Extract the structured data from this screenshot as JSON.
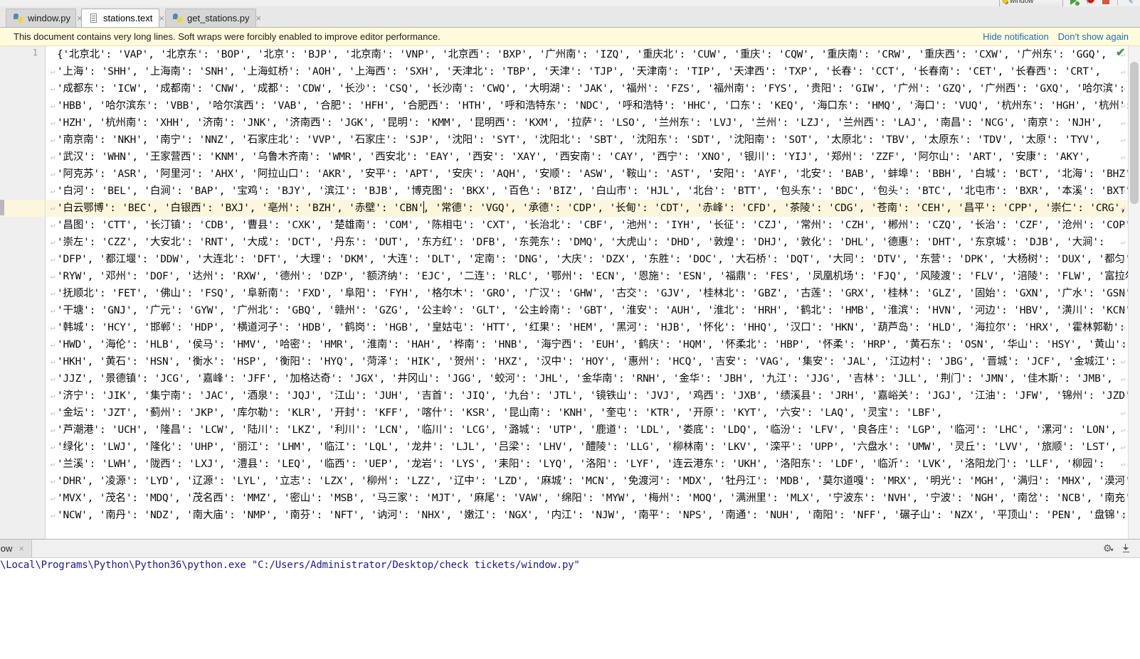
{
  "toolbar": {
    "run_config_label": "window",
    "run_icon": "run-icon",
    "debug_icon": "debug-icon",
    "stop_icon": "stop-icon",
    "wrench_icon": "wrench-icon"
  },
  "tabs": [
    {
      "label": "window.py",
      "icon": "python-file-icon",
      "active": false,
      "close": "×"
    },
    {
      "label": "stations.text",
      "icon": "text-file-icon",
      "active": true,
      "close": "×"
    },
    {
      "label": "get_stations.py",
      "icon": "python-file-icon",
      "active": false,
      "close": "×"
    }
  ],
  "notification": {
    "message": "This document contains very long lines. Soft wraps were forcibly enabled to improve editor performance.",
    "hide_label": "Hide notification",
    "dont_show_label": "Don't show again",
    "link_color": "#1d6fb8",
    "background": "#fffbdc"
  },
  "editor": {
    "line_number": "1",
    "wrap_glyph": "↵",
    "wrap_right_glyph": "↵",
    "caret_line_index": 9,
    "caret_color": "#000000",
    "highlight_color": "#fdf6dd",
    "inspection_ok_glyph": "✔",
    "inspection_ok_color": "#3f9e3f",
    "lines": [
      "{'北京北': 'VAP', '北京东': 'BOP', '北京': 'BJP', '北京南': 'VNP', '北京西': 'BXP', '广州南': 'IZQ', '重庆北': 'CUW', '重庆': 'CQW', '重庆南': 'CRW', '重庆西': 'CXW', '广州东': 'GGQ',",
      "'上海': 'SHH', '上海南': 'SNH', '上海虹桥': 'AOH', '上海西': 'SXH', '天津北': 'TBP', '天津': 'TJP', '天津南': 'TIP', '天津西': 'TXP', '长春': 'CCT', '长春南': 'CET', '长春西': 'CRT',",
      "'成都东': 'ICW', '成都南': 'CNW', '成都': 'CDW', '长沙': 'CSQ', '长沙南': 'CWQ', '大明湖': 'JAK', '福州': 'FZS', '福州南': 'FYS', '贵阳': 'GIW', '广州': 'GZQ', '广州西': 'GXQ', '哈尔滨':",
      "'HBB', '哈尔滨东': 'VBB', '哈尔滨西': 'VAB', '合肥': 'HFH', '合肥西': 'HTH', '呼和浩特东': 'NDC', '呼和浩特': 'HHC', '口东': 'KEQ', '海口东': 'HMQ', '海口': 'VUQ', '杭州东': 'HGH', '杭州':",
      "'HZH', '杭州南': 'XHH', '济南': 'JNK', '济南西': 'JGK', '昆明': 'KMM', '昆明西': 'KXM', '拉萨': 'LSO', '兰州东': 'LVJ', '兰州': 'LZJ', '兰州西': 'LAJ', '南昌': 'NCG', '南京': 'NJH',",
      "'南京南': 'NKH', '南宁': 'NNZ', '石家庄北': 'VVP', '石家庄': 'SJP', '沈阳': 'SYT', '沈阳北': 'SBT', '沈阳东': 'SDT', '沈阳南': 'SOT', '太原北': 'TBV', '太原东': 'TDV', '太原': 'TYV',",
      "'武汉': 'WHN', '王家营西': 'KNM', '乌鲁木齐南': 'WMR', '西安北': 'EAY', '西安': 'XAY', '西安南': 'CAY', '西宁': 'XNO', '银川': 'YIJ', '郑州': 'ZZF', '阿尔山': 'ART', '安康': 'AKY',",
      "'阿克苏': 'ASR', '阿里河': 'AHX', '阿拉山口': 'AKR', '安平': 'APT', '安庆': 'AQH', '安顺': 'ASW', '鞍山': 'AST', '安阳': 'AYF', '北安': 'BAB', '蚌埠': 'BBH', '白城': 'BCT', '北海': 'BHZ',",
      "'白河': 'BEL', '白涧': 'BAP', '宝鸡': 'BJY', '滨江': 'BJB', '博克图': 'BKX', '百色': 'BIZ', '白山市': 'HJL', '北台': 'BTT', '包头东': 'BDC', '包头': 'BTC', '北屯市': 'BXR', '本溪': 'BXT',",
      "'白云鄂博': 'BEC', '白银西': 'BXJ', '亳州': 'BZH', '赤壁': 'CBN', '常德': 'VGQ', '承德': 'CDP', '长甸': 'CDT', '赤峰': 'CFD', '茶陵': 'CDG', '苍南': 'CEH', '昌平': 'CPP', '崇仁': 'CRG',",
      "'昌图': 'CTT', '长汀镇': 'CDB', '曹县': 'CXK', '楚雄南': 'COM', '陈相屯': 'CXT', '长治北': 'CBF', '池州': 'IYH', '长征': 'CZJ', '常州': 'CZH', '郴州': 'CZQ', '长治': 'CZF', '沧州': 'COP',",
      "'崇左': 'CZZ', '大安北': 'RNT', '大成': 'DCT', '丹东': 'DUT', '东方红': 'DFB', '东莞东': 'DMQ', '大虎山': 'DHD', '敦煌': 'DHJ', '敦化': 'DHL', '德惠': 'DHT', '东京城': 'DJB', '大涧':",
      "'DFP', '都江堰': 'DDW', '大连北': 'DFT', '大理': 'DKM', '大连': 'DLT', '定南': 'DNG', '大庆': 'DZX', '东胜': 'DOC', '大石桥': 'DQT', '大同': 'DTV', '东营': 'DPK', '大杨树': 'DUX', '都匀':",
      "'RYW', '邓州': 'DOF', '达州': 'RXW', '德州': 'DZP', '额济纳': 'EJC', '二连': 'RLC', '鄂州': 'ECN', '恩施': 'ESN', '福鼎': 'FES', '凤凰机场': 'FJQ', '风陵渡': 'FLV', '涪陵': 'FLW', '富拉尔基': 'FRX',",
      "'抚顺北': 'FET', '佛山': 'FSQ', '阜新南': 'FXD', '阜阳': 'FYH', '格尔木': 'GRO', '广汉': 'GHW', '古交': 'GJV', '桂林北': 'GBZ', '古莲': 'GRX', '桂林': 'GLZ', '固始': 'GXN', '广水': 'GSN',",
      "'干塘': 'GNJ', '广元': 'GYW', '广州北': 'GBQ', '赣州': 'GZG', '公主岭': 'GLT', '公主岭南': 'GBT', '淮安': 'AUH', '淮北': 'HRH', '鹤北': 'HMB', '淮滨': 'HVN', '河边': 'HBV', '潢川': 'KCN',",
      "'韩城': 'HCY', '邯郸': 'HDP', '横道河子': 'HDB', '鹤岗': 'HGB', '皇姑屯': 'HTT', '红果': 'HEM', '黑河': 'HJB', '怀化': 'HHQ', '汉口': 'HKN', '葫芦岛': 'HLD', '海拉尔': 'HRX', '霍林郭勒':",
      "'HWD', '海伦': 'HLB', '侯马': 'HMV', '哈密': 'HMR', '淮南': 'HAH', '桦南': 'HNB', '海宁西': 'EUH', '鹤庆': 'HQM', '怀柔北': 'HBP', '怀柔': 'HRP', '黄石东': 'OSN', '华山': 'HSY', '黄山':",
      "'HKH', '黄石': 'HSN', '衡水': 'HSP', '衡阳': 'HYQ', '菏泽': 'HIK', '贺州': 'HXZ', '汉中': 'HOY', '惠州': 'HCQ', '吉安': 'VAG', '集安': 'JAL', '江边村': 'JBG', '晋城': 'JCF', '金城江':",
      "'JJZ', '景德镇': 'JCG', '嘉峰': 'JFF', '加格达奇': 'JGX', '井冈山': 'JGG', '蛟河': 'JHL', '金华南': 'RNH', '金华': 'JBH', '九江': 'JJG', '吉林': 'JLL', '荆门': 'JMN', '佳木斯': 'JMB',",
      "'济宁': 'JIK', '集宁南': 'JAC', '酒泉': 'JQJ', '江山': 'JUH', '吉首': 'JIQ', '九台': 'JTL', '镜铁山': 'JVJ', '鸡西': 'JXB', '绩溪县': 'JRH', '嘉峪关': 'JGJ', '江油': 'JFW', '锦州': 'JZD',",
      "'金坛': 'JZT', '蓟州': 'JKP', '库尔勒': 'KLR', '开封': 'KFF', '喀什': 'KSR', '昆山南': 'KNH', '奎屯': 'KTR', '开原': 'KYT', '六安': 'LAQ', '灵宝': 'LBF',",
      "'芦潮港': 'UCH', '隆昌': 'LCW', '陆川': 'LKZ', '利川': 'LCN', '临川': 'LCG', '潞城': 'UTP', '鹿道': 'LDL', '娄底': 'LDQ', '临汾': 'LFV', '良各庄': 'LGP', '临河': 'LHC', '漯河': 'LON',",
      "'绿化': 'LWJ', '隆化': 'UHP', '丽江': 'LHM', '临江': 'LQL', '龙井': 'LJL', '吕梁': 'LHV', '醴陵': 'LLG', '柳林南': 'LKV', '滦平': 'UPP', '六盘水': 'UMW', '灵丘': 'LVV', '旅顺': 'LST',",
      "'兰溪': 'LWH', '陇西': 'LXJ', '澧县': 'LEQ', '临西': 'UEP', '龙岩': 'LYS', '耒阳': 'LYQ', '洛阳': 'LYF', '连云港东': 'UKH', '洛阳东': 'LDF', '临沂': 'LVK', '洛阳龙门': 'LLF', '柳园':",
      "'DHR', '凌源': 'LYD', '辽源': 'LYL', '立志': 'LZX', '柳州': 'LZZ', '辽中': 'LZD', '麻城': 'MCN', '免渡河': 'MDX', '牡丹江': 'MDB', '莫尔道嘎': 'MRX', '明光': 'MGH', '满归': 'MHX', '漠河':",
      "'MVX', '茂名': 'MDQ', '茂名西': 'MMZ', '密山': 'MSB', '马三家': 'MJT', '麻尾': 'VAW', '绵阳': 'MYW', '梅州': 'MOQ', '满洲里': 'MLX', '宁波东': 'NVH', '宁波': 'NGH', '南岔': 'NCB', '南充':",
      "'NCW', '南丹': 'NDZ', '南大庙': 'NMP', '南芬': 'NFT', '讷河': 'NHX', '嫩江': 'NGX', '内江': 'NJW', '南平': 'NPS', '南通': 'NUH', '南阳': 'NFF', '碾子山': 'NZX', '平顶山': 'PEN', '盘锦':"
    ]
  },
  "run_panel": {
    "tab_label": "window",
    "tab_close": "×",
    "gear_icon": "gear-icon",
    "gear_caret": "▾",
    "hide_icon": "hide-panel-icon",
    "console_output": "\\Local\\Programs\\Python\\Python36\\python.exe \"C:/Users/Administrator/Desktop/check tickets/window.py\"",
    "console_text_color": "#1b1b8f"
  }
}
